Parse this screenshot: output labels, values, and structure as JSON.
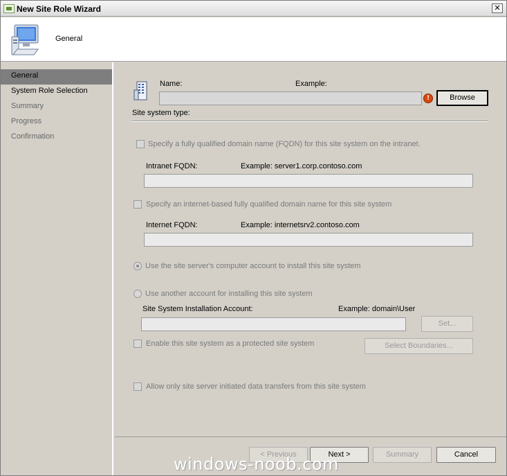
{
  "window": {
    "title": "New Site Role Wizard",
    "close_glyph": "✕"
  },
  "banner": {
    "title": "General",
    "icon": "computer-icon"
  },
  "sidebar": {
    "items": [
      {
        "label": "General",
        "state": "active"
      },
      {
        "label": "System Role Selection",
        "state": "normal"
      },
      {
        "label": "Summary",
        "state": "disabled"
      },
      {
        "label": "Progress",
        "state": "disabled"
      },
      {
        "label": "Confirmation",
        "state": "disabled"
      }
    ]
  },
  "general": {
    "name_label": "Name:",
    "example_label": "Example:",
    "name_value": "",
    "error_glyph": "!",
    "browse_label": "Browse",
    "site_system_type_label": "Site system type:"
  },
  "intranet": {
    "checkbox_label": "Specify a fully qualified domain name (FQDN) for this site system on the intranet.",
    "fqdn_label": "Intranet FQDN:",
    "example": "Example: server1.corp.contoso.com",
    "value": ""
  },
  "internet": {
    "checkbox_label": "Specify an internet-based fully qualified domain name for this site system",
    "fqdn_label": "Internet FQDN:",
    "example": "Example: internetsrv2.contoso.com",
    "value": ""
  },
  "account": {
    "use_server_account_label": "Use the site server's computer account to install this site system",
    "use_other_account_label": "Use another account for installing this site system",
    "installation_account_label": "Site System Installation Account:",
    "example": "Example: domain\\User",
    "value": "",
    "set_button_label": "Set..."
  },
  "protected": {
    "checkbox_label": "Enable this site system as a protected site system",
    "select_boundaries_label": "Select Boundaries..."
  },
  "transfers": {
    "checkbox_label": "Allow only site server initiated data transfers from this site system"
  },
  "footer": {
    "previous_label": "< Previous",
    "next_label": "Next >",
    "summary_label": "Summary",
    "cancel_label": "Cancel"
  },
  "watermark": "windows-noob.com"
}
